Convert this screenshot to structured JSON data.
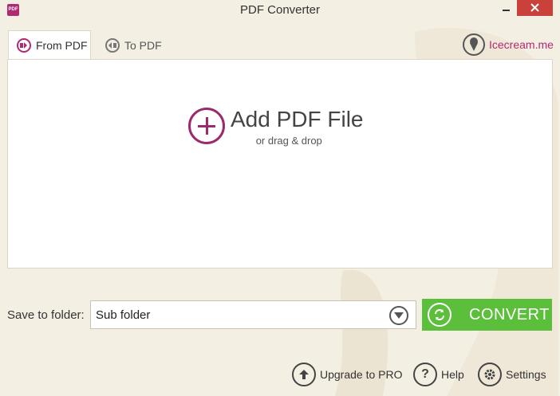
{
  "titlebar": {
    "app_icon_text": "PDF",
    "title": "PDF Converter"
  },
  "tabs": [
    {
      "label": "From PDF",
      "active": true,
      "icon": "from-pdf-icon"
    },
    {
      "label": "To PDF",
      "active": false,
      "icon": "to-pdf-icon"
    }
  ],
  "brand": {
    "text": "Icecream.me",
    "icon": "icecream-logo-icon"
  },
  "drop_area": {
    "title": "Add PDF File",
    "subtitle": "or drag & drop"
  },
  "save": {
    "label": "Save to folder:",
    "selected": "Sub folder"
  },
  "convert": {
    "label": "CONVERT"
  },
  "bottom": {
    "upgrade": "Upgrade to PRO",
    "help": "Help",
    "help_glyph": "?",
    "settings": "Settings"
  },
  "colors": {
    "accent": "#b02a72",
    "convert": "#5cbf3c",
    "close": "#c9413a",
    "background": "#f4efe3"
  }
}
